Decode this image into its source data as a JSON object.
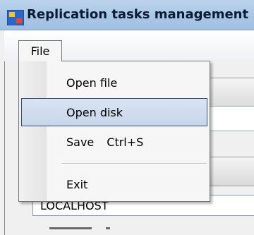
{
  "window": {
    "title": "Replication tasks management"
  },
  "menubar": {
    "file_label": "File"
  },
  "file_menu": {
    "items": [
      {
        "label": "Open file"
      },
      {
        "label": "Open disk"
      },
      {
        "label": "Save",
        "shortcut": "Ctrl+S"
      },
      {
        "label": "Exit"
      }
    ],
    "highlighted": "Open disk"
  },
  "form": {
    "host_value": "LOCALHOST"
  }
}
